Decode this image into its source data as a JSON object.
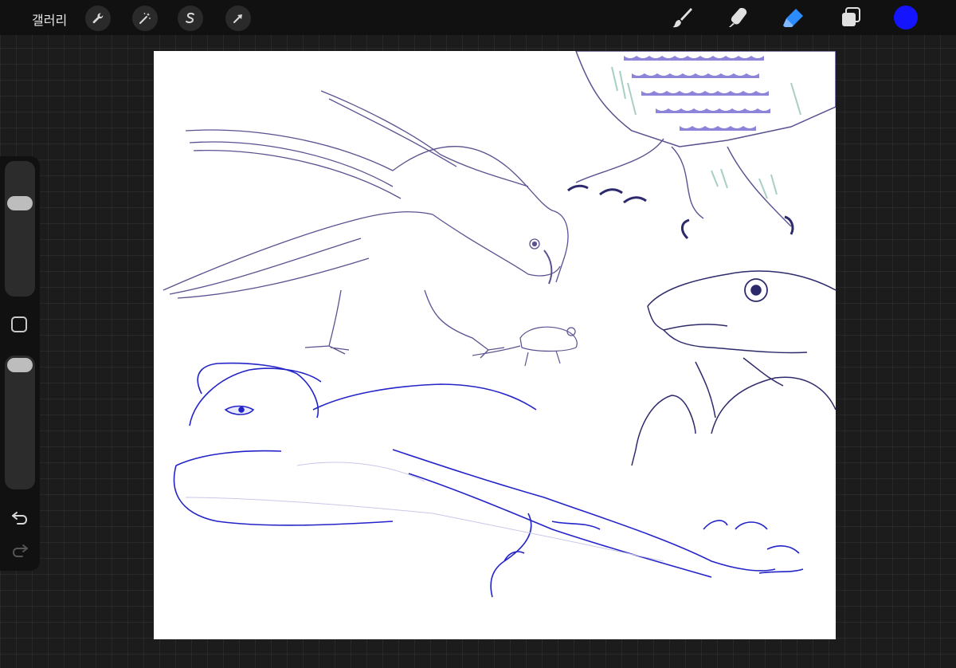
{
  "topbar": {
    "gallery_label": "갤러리",
    "left_tools": [
      "wrench-icon",
      "magic-wand-icon",
      "selection-icon",
      "transform-arrow-icon"
    ],
    "right_tools": [
      "brush-icon",
      "smudge-icon",
      "eraser-icon",
      "layers-icon"
    ],
    "active_tool": "eraser-icon",
    "current_color": "#1414ff"
  },
  "sidebar": {
    "brush_size_level": 0.18,
    "opacity_level": 0.05,
    "icons": [
      "modify-square-icon",
      "undo-icon",
      "redo-icon"
    ]
  },
  "canvas": {
    "description_colors": {
      "sketch_purple": "#5a5290",
      "feather_lavender": "#8c84d8",
      "feather_teal": "#a8cfc5",
      "ink_blue": "#2323c8"
    }
  }
}
